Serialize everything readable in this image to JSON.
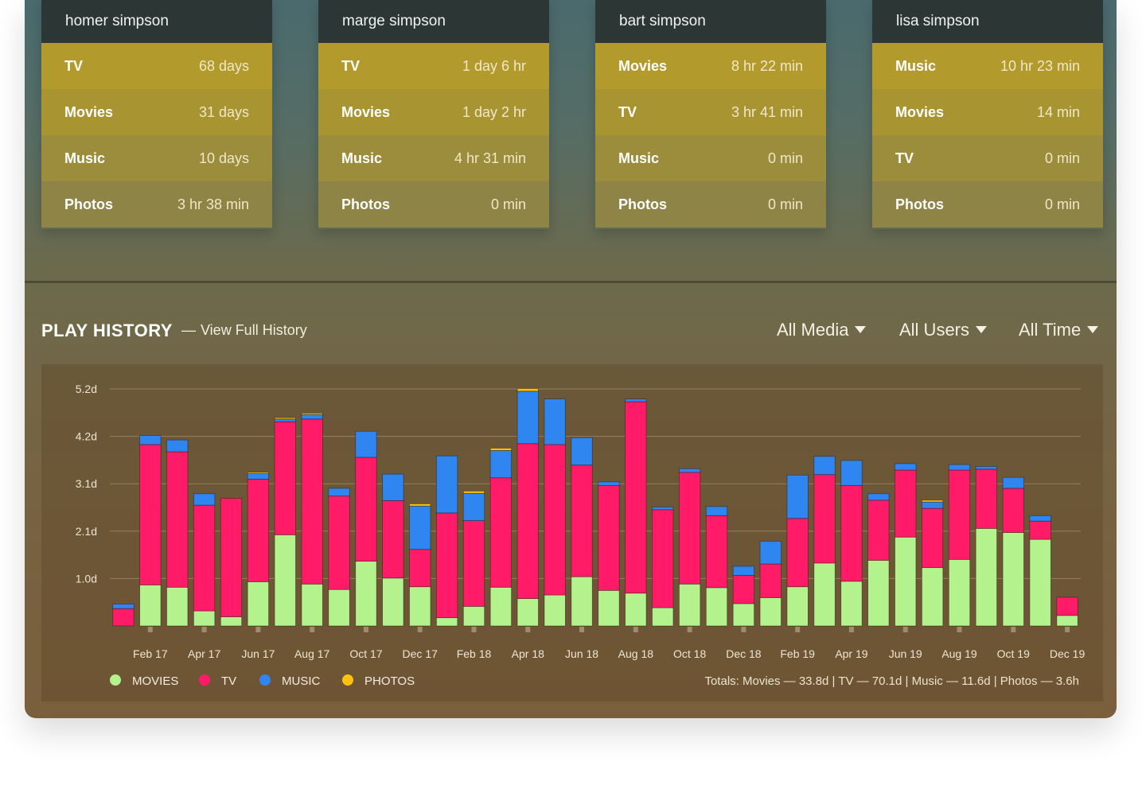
{
  "users": [
    {
      "name": "homer simpson",
      "stats": [
        {
          "label": "TV",
          "value": "68 days"
        },
        {
          "label": "Movies",
          "value": "31 days"
        },
        {
          "label": "Music",
          "value": "10 days"
        },
        {
          "label": "Photos",
          "value": "3 hr 38 min"
        }
      ]
    },
    {
      "name": "marge simpson",
      "stats": [
        {
          "label": "TV",
          "value": "1 day 6 hr"
        },
        {
          "label": "Movies",
          "value": "1 day 2 hr"
        },
        {
          "label": "Music",
          "value": "4 hr 31 min"
        },
        {
          "label": "Photos",
          "value": "0 min"
        }
      ]
    },
    {
      "name": "bart simpson",
      "stats": [
        {
          "label": "Movies",
          "value": "8 hr 22 min"
        },
        {
          "label": "TV",
          "value": "3 hr 41 min"
        },
        {
          "label": "Music",
          "value": "0 min"
        },
        {
          "label": "Photos",
          "value": "0 min"
        }
      ]
    },
    {
      "name": "lisa simpson",
      "stats": [
        {
          "label": "Music",
          "value": "10 hr 23 min"
        },
        {
          "label": "Movies",
          "value": "14 min"
        },
        {
          "label": "TV",
          "value": "0 min"
        },
        {
          "label": "Photos",
          "value": "0 min"
        }
      ]
    }
  ],
  "history": {
    "title": "PLAY HISTORY",
    "link_dash": "—",
    "link_label": "View Full History",
    "filters": {
      "media": "All Media",
      "users": "All Users",
      "time": "All Time"
    },
    "totals": "Totals: Movies — 33.8d | TV — 70.1d | Music — 11.6d | Photos — 3.6h"
  },
  "colors": {
    "movies": "#b4f28e",
    "tv": "#ff1b68",
    "music": "#2f86f0",
    "photos": "#fcc20f"
  },
  "chart_data": {
    "type": "bar",
    "stacked": true,
    "categories": [
      "Jan 17",
      "Feb 17",
      "Mar 17",
      "Apr 17",
      "May 17",
      "Jun 17",
      "Jul 17",
      "Aug 17",
      "Sep 17",
      "Oct 17",
      "Nov 17",
      "Dec 17",
      "Jan 18",
      "Feb 18",
      "Mar 18",
      "Apr 18",
      "May 18",
      "Jun 18",
      "Jul 18",
      "Aug 18",
      "Sep 18",
      "Oct 18",
      "Nov 18",
      "Dec 18",
      "Jan 19",
      "Feb 19",
      "Mar 19",
      "Apr 19",
      "May 19",
      "Jun 19",
      "Jul 19",
      "Aug 19",
      "Sep 19",
      "Oct 19",
      "Nov 19",
      "Dec 19"
    ],
    "x_tick_labels": [
      "Feb 17",
      "Apr 17",
      "Jun 17",
      "Aug 17",
      "Oct 17",
      "Dec 17",
      "Feb 18",
      "Apr 18",
      "Jun 18",
      "Aug 18",
      "Oct 18",
      "Dec 18",
      "Feb 19",
      "Apr 19",
      "Jun 19",
      "Aug 19",
      "Oct 19",
      "Dec 19"
    ],
    "y_tick_labels": [
      "1.0d",
      "2.1d",
      "3.1d",
      "4.2d",
      "5.2d"
    ],
    "y_tick_values": [
      1.04,
      2.08,
      3.12,
      4.16,
      5.2
    ],
    "ylim": [
      0,
      5.2
    ],
    "series": [
      {
        "name": "MOVIES",
        "values": [
          0.0,
          0.9,
          0.85,
          0.33,
          0.2,
          0.97,
          2.0,
          0.92,
          0.8,
          1.42,
          1.05,
          0.86,
          0.18,
          0.43,
          0.85,
          0.6,
          0.68,
          1.08,
          0.78,
          0.72,
          0.4,
          0.92,
          0.84,
          0.49,
          0.62,
          0.86,
          1.38,
          0.98,
          1.44,
          1.95,
          1.28,
          1.46,
          2.14,
          2.05,
          1.9,
          0.23
        ]
      },
      {
        "name": "TV",
        "values": [
          0.38,
          3.08,
          2.97,
          2.32,
          2.6,
          2.25,
          2.48,
          3.62,
          2.05,
          2.28,
          1.7,
          0.82,
          2.3,
          1.88,
          2.4,
          3.4,
          3.3,
          2.45,
          2.3,
          4.2,
          2.15,
          2.45,
          1.58,
          0.62,
          0.74,
          1.5,
          1.94,
          2.1,
          1.32,
          1.47,
          1.3,
          1.96,
          1.3,
          0.97,
          0.4,
          0.4
        ]
      },
      {
        "name": "MUSIC",
        "values": [
          0.1,
          0.2,
          0.26,
          0.25,
          0.0,
          0.12,
          0.06,
          0.1,
          0.17,
          0.57,
          0.58,
          0.95,
          1.25,
          0.6,
          0.6,
          1.15,
          1.0,
          0.6,
          0.08,
          0.06,
          0.06,
          0.08,
          0.2,
          0.2,
          0.5,
          0.95,
          0.4,
          0.55,
          0.14,
          0.14,
          0.14,
          0.12,
          0.06,
          0.24,
          0.12,
          0.0
        ]
      },
      {
        "name": "PHOTOS",
        "values": [
          0,
          0,
          0,
          0,
          0,
          0.03,
          0.03,
          0.03,
          0,
          0,
          0,
          0.05,
          0,
          0.05,
          0.05,
          0.06,
          0,
          0,
          0,
          0,
          0,
          0,
          0,
          0,
          0,
          0,
          0,
          0,
          0,
          0,
          0.04,
          0,
          0,
          0,
          0,
          0
        ]
      }
    ]
  }
}
